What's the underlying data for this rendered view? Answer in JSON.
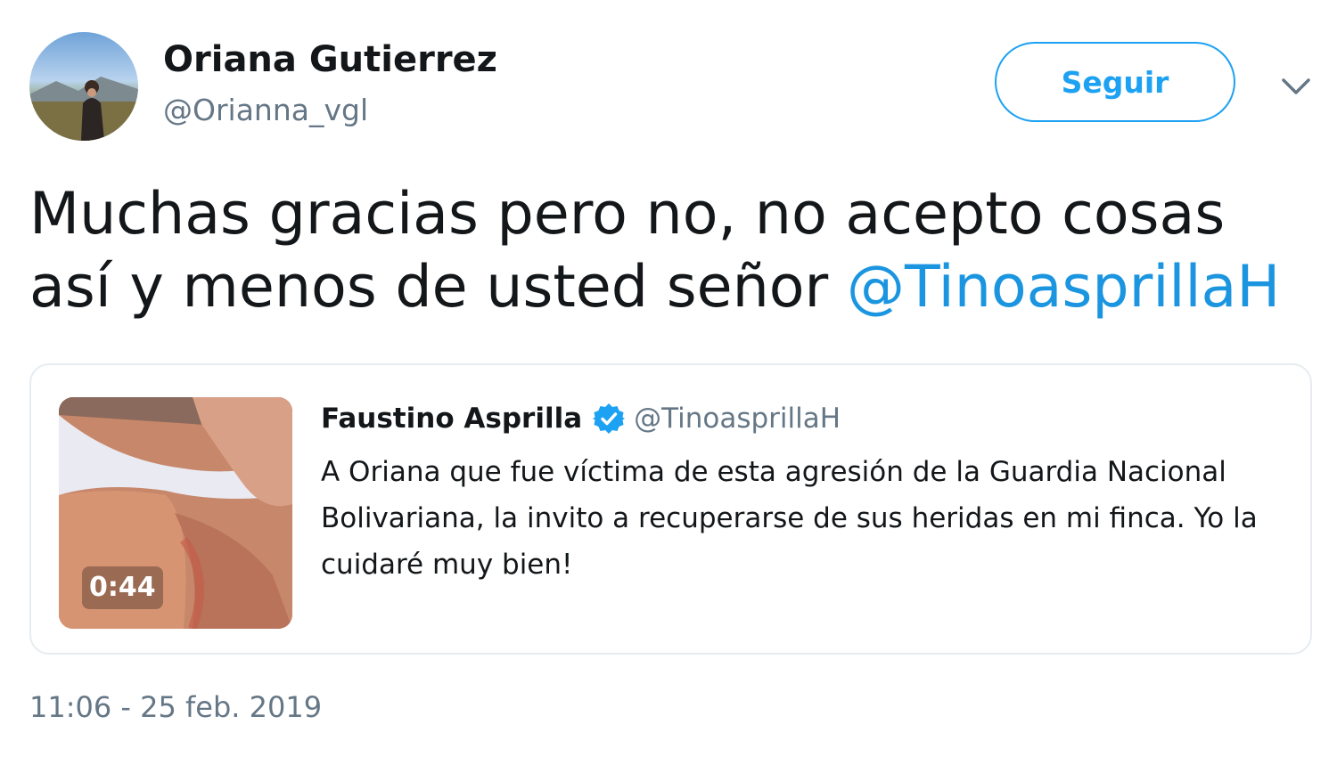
{
  "author": {
    "name": "Oriana Gutierrez",
    "handle": "@Orianna_vgl"
  },
  "follow_button": {
    "label": "Seguir"
  },
  "tweet": {
    "text_before": "Muchas gracias pero no, no acepto cosas así y menos de usted señor",
    "mention": "@TinoasprillaH"
  },
  "quoted_tweet": {
    "author_name": "Faustino Asprilla",
    "verified": true,
    "handle": "@TinoasprillaH",
    "text": "A Oriana que fue víctima de esta agresión de la Guardia Nacional Bolivariana, la invito a recuperarse de sus heridas en mi finca. Yo la cuidaré muy bien!",
    "media": {
      "type": "video",
      "duration": "0:44"
    }
  },
  "timestamp": "11:06 - 25 feb. 2019",
  "colors": {
    "accent": "#1da1f2",
    "mention": "#1b95e0",
    "text_primary": "#14171a",
    "text_secondary": "#657786",
    "border": "#e6ecf0"
  },
  "icons": {
    "caret": "chevron-down-icon",
    "verified": "verified-badge-icon"
  }
}
